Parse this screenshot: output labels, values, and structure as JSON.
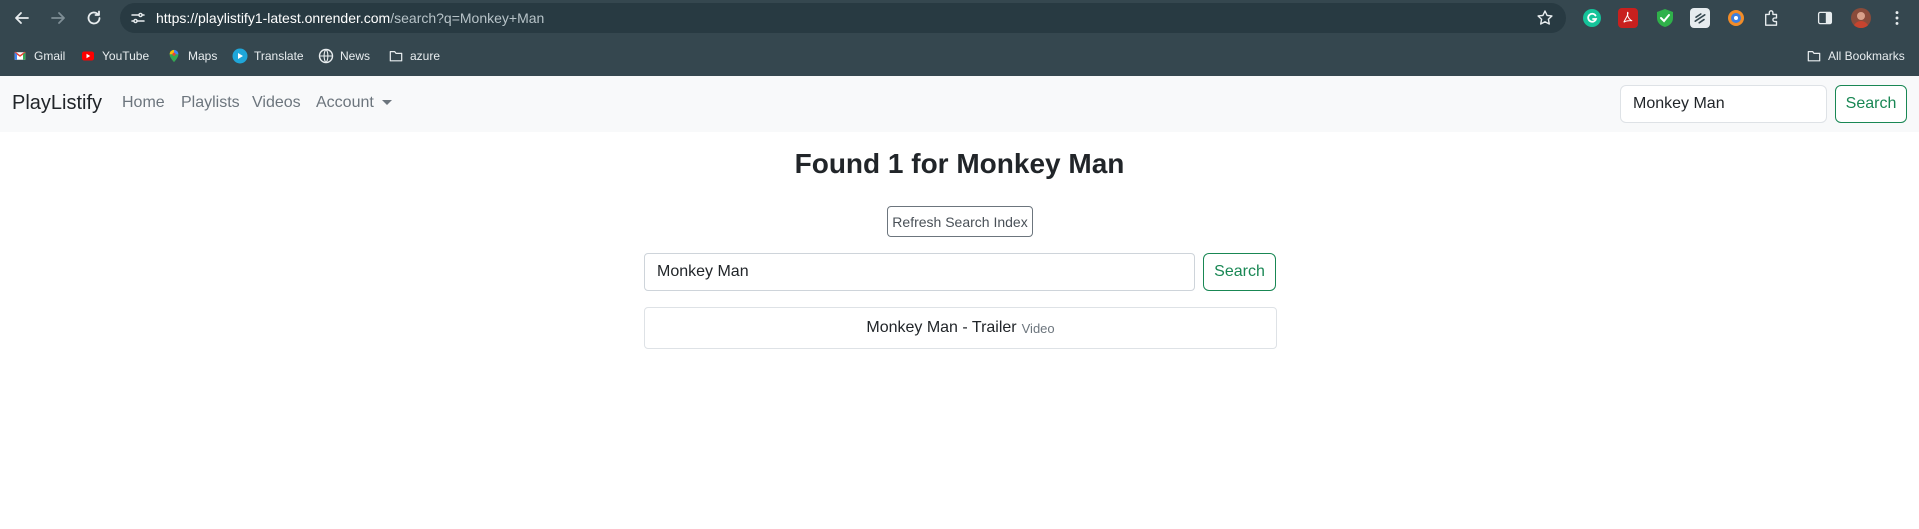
{
  "browser": {
    "url_host": "https://playlistify1-latest.onrender.com",
    "url_path": "/search?q=Monkey+Man",
    "bookmarks": [
      {
        "label": "Gmail",
        "icon": "gmail-icon"
      },
      {
        "label": "YouTube",
        "icon": "youtube-icon"
      },
      {
        "label": "Maps",
        "icon": "maps-icon"
      },
      {
        "label": "Translate",
        "icon": "translate-icon"
      },
      {
        "label": "News",
        "icon": "news-icon"
      },
      {
        "label": "azure",
        "icon": "folder-icon"
      }
    ],
    "all_bookmarks": "All Bookmarks"
  },
  "navbar": {
    "brand": "PlayListify",
    "links": [
      "Home",
      "Playlists",
      "Videos",
      "Account"
    ],
    "search_value": "Monkey Man",
    "search_button": "Search"
  },
  "main": {
    "heading": "Found 1 for Monkey Man",
    "refresh_button": "Refresh Search Index",
    "search_value": "Monkey Man",
    "search_button": "Search",
    "results": [
      {
        "title": "Monkey Man - Trailer",
        "type": "Video"
      }
    ]
  },
  "colors": {
    "chrome": "#35474f",
    "omnibox": "#283a42",
    "accent_green": "#198754",
    "navbar_bg": "#f8f9fa"
  }
}
